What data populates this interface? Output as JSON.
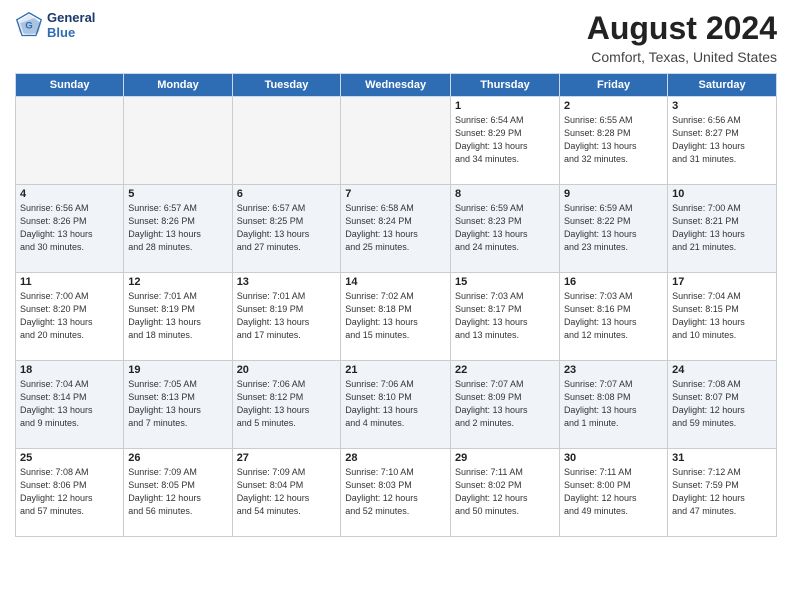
{
  "logo": {
    "text_line1": "General",
    "text_line2": "Blue"
  },
  "header": {
    "month": "August 2024",
    "location": "Comfort, Texas, United States"
  },
  "weekdays": [
    "Sunday",
    "Monday",
    "Tuesday",
    "Wednesday",
    "Thursday",
    "Friday",
    "Saturday"
  ],
  "weeks": [
    [
      {
        "day": "",
        "info": "",
        "empty": true
      },
      {
        "day": "",
        "info": "",
        "empty": true
      },
      {
        "day": "",
        "info": "",
        "empty": true
      },
      {
        "day": "",
        "info": "",
        "empty": true
      },
      {
        "day": "1",
        "info": "Sunrise: 6:54 AM\nSunset: 8:29 PM\nDaylight: 13 hours\nand 34 minutes."
      },
      {
        "day": "2",
        "info": "Sunrise: 6:55 AM\nSunset: 8:28 PM\nDaylight: 13 hours\nand 32 minutes."
      },
      {
        "day": "3",
        "info": "Sunrise: 6:56 AM\nSunset: 8:27 PM\nDaylight: 13 hours\nand 31 minutes."
      }
    ],
    [
      {
        "day": "4",
        "info": "Sunrise: 6:56 AM\nSunset: 8:26 PM\nDaylight: 13 hours\nand 30 minutes."
      },
      {
        "day": "5",
        "info": "Sunrise: 6:57 AM\nSunset: 8:26 PM\nDaylight: 13 hours\nand 28 minutes."
      },
      {
        "day": "6",
        "info": "Sunrise: 6:57 AM\nSunset: 8:25 PM\nDaylight: 13 hours\nand 27 minutes."
      },
      {
        "day": "7",
        "info": "Sunrise: 6:58 AM\nSunset: 8:24 PM\nDaylight: 13 hours\nand 25 minutes."
      },
      {
        "day": "8",
        "info": "Sunrise: 6:59 AM\nSunset: 8:23 PM\nDaylight: 13 hours\nand 24 minutes."
      },
      {
        "day": "9",
        "info": "Sunrise: 6:59 AM\nSunset: 8:22 PM\nDaylight: 13 hours\nand 23 minutes."
      },
      {
        "day": "10",
        "info": "Sunrise: 7:00 AM\nSunset: 8:21 PM\nDaylight: 13 hours\nand 21 minutes."
      }
    ],
    [
      {
        "day": "11",
        "info": "Sunrise: 7:00 AM\nSunset: 8:20 PM\nDaylight: 13 hours\nand 20 minutes."
      },
      {
        "day": "12",
        "info": "Sunrise: 7:01 AM\nSunset: 8:19 PM\nDaylight: 13 hours\nand 18 minutes."
      },
      {
        "day": "13",
        "info": "Sunrise: 7:01 AM\nSunset: 8:19 PM\nDaylight: 13 hours\nand 17 minutes."
      },
      {
        "day": "14",
        "info": "Sunrise: 7:02 AM\nSunset: 8:18 PM\nDaylight: 13 hours\nand 15 minutes."
      },
      {
        "day": "15",
        "info": "Sunrise: 7:03 AM\nSunset: 8:17 PM\nDaylight: 13 hours\nand 13 minutes."
      },
      {
        "day": "16",
        "info": "Sunrise: 7:03 AM\nSunset: 8:16 PM\nDaylight: 13 hours\nand 12 minutes."
      },
      {
        "day": "17",
        "info": "Sunrise: 7:04 AM\nSunset: 8:15 PM\nDaylight: 13 hours\nand 10 minutes."
      }
    ],
    [
      {
        "day": "18",
        "info": "Sunrise: 7:04 AM\nSunset: 8:14 PM\nDaylight: 13 hours\nand 9 minutes."
      },
      {
        "day": "19",
        "info": "Sunrise: 7:05 AM\nSunset: 8:13 PM\nDaylight: 13 hours\nand 7 minutes."
      },
      {
        "day": "20",
        "info": "Sunrise: 7:06 AM\nSunset: 8:12 PM\nDaylight: 13 hours\nand 5 minutes."
      },
      {
        "day": "21",
        "info": "Sunrise: 7:06 AM\nSunset: 8:10 PM\nDaylight: 13 hours\nand 4 minutes."
      },
      {
        "day": "22",
        "info": "Sunrise: 7:07 AM\nSunset: 8:09 PM\nDaylight: 13 hours\nand 2 minutes."
      },
      {
        "day": "23",
        "info": "Sunrise: 7:07 AM\nSunset: 8:08 PM\nDaylight: 13 hours\nand 1 minute."
      },
      {
        "day": "24",
        "info": "Sunrise: 7:08 AM\nSunset: 8:07 PM\nDaylight: 12 hours\nand 59 minutes."
      }
    ],
    [
      {
        "day": "25",
        "info": "Sunrise: 7:08 AM\nSunset: 8:06 PM\nDaylight: 12 hours\nand 57 minutes."
      },
      {
        "day": "26",
        "info": "Sunrise: 7:09 AM\nSunset: 8:05 PM\nDaylight: 12 hours\nand 56 minutes."
      },
      {
        "day": "27",
        "info": "Sunrise: 7:09 AM\nSunset: 8:04 PM\nDaylight: 12 hours\nand 54 minutes."
      },
      {
        "day": "28",
        "info": "Sunrise: 7:10 AM\nSunset: 8:03 PM\nDaylight: 12 hours\nand 52 minutes."
      },
      {
        "day": "29",
        "info": "Sunrise: 7:11 AM\nSunset: 8:02 PM\nDaylight: 12 hours\nand 50 minutes."
      },
      {
        "day": "30",
        "info": "Sunrise: 7:11 AM\nSunset: 8:00 PM\nDaylight: 12 hours\nand 49 minutes."
      },
      {
        "day": "31",
        "info": "Sunrise: 7:12 AM\nSunset: 7:59 PM\nDaylight: 12 hours\nand 47 minutes."
      }
    ]
  ]
}
